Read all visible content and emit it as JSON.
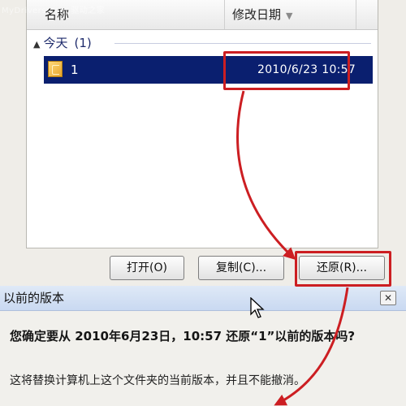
{
  "watermark": "MyDrivers.com 驱动之家",
  "list": {
    "columns": [
      {
        "label": "名称"
      },
      {
        "label": "修改日期"
      }
    ],
    "group": {
      "label": "今天",
      "count": "(1)"
    },
    "rows": [
      {
        "name": "1",
        "date": "2010/6/23 10:57",
        "selected": true
      }
    ]
  },
  "buttons": {
    "open": "打开(O)",
    "copy": "复制(C)...",
    "restore": "还原(R)..."
  },
  "dialog": {
    "title": "以前的版本",
    "close_label": "✕",
    "question": "您确定要从 2010年6月23日，10:57 还原“1”以前的版本吗?",
    "message": "这将替换计算机上这个文件夹的当前版本，并且不能撤消。"
  },
  "colors": {
    "selection": "#0a1f6f",
    "highlight": "#cc1e22",
    "title_bar": "#c9d9f1"
  },
  "icons": {
    "file": "folder-icon",
    "sort": "sort-down-icon",
    "group_toggle": "collapse-arrow-icon",
    "close": "close-icon",
    "pointer": "mouse-cursor-icon"
  }
}
